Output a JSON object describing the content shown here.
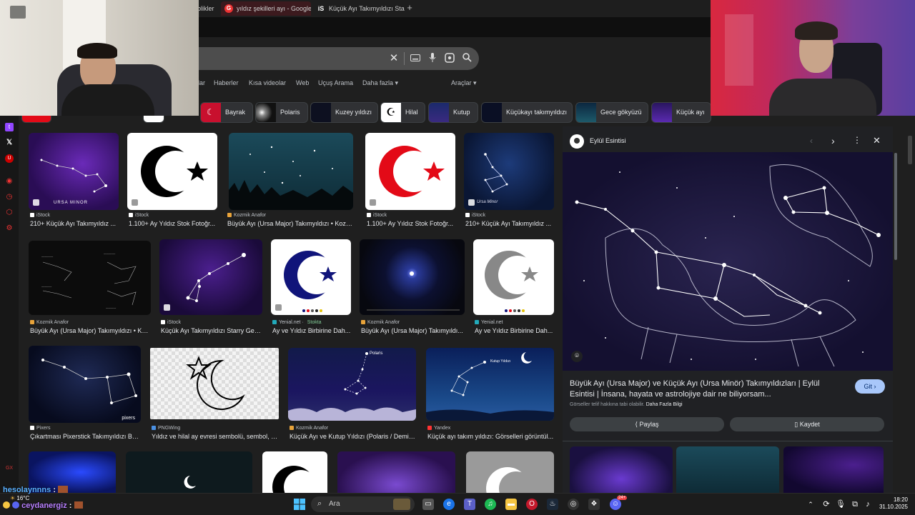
{
  "tabs": [
    {
      "label": "blikler",
      "active": false
    },
    {
      "label": "yıldız şekilleri ayı - Google",
      "active": true
    },
    {
      "label": "Küçük Ayı Takımyıldızı Sta",
      "active": false
    }
  ],
  "new_tab_label": "+",
  "search": {
    "value": "",
    "placeholder": ""
  },
  "nav_links": [
    "lar",
    "Haberler",
    "Kısa videolar",
    "Web",
    "Uçuş Arama",
    "Daha fazla"
  ],
  "tools_label": "Araçlar",
  "chips": [
    {
      "label": "Bayrak"
    },
    {
      "label": "Polaris"
    },
    {
      "label": "Kuzey yıldızı"
    },
    {
      "label": "Hilal"
    },
    {
      "label": "Kutup"
    },
    {
      "label": "Küçükayı takımyıldızı"
    },
    {
      "label": "Gece gökyüzü"
    },
    {
      "label": "Küçük ayı"
    }
  ],
  "results": [
    {
      "source": "iStock",
      "title": "210+ Küçük Ayı Takımyıldız ..."
    },
    {
      "source": "iStock",
      "title": "1.100+ Ay Yıldız Stok Fotoğr..."
    },
    {
      "source": "Kozmik Anafor",
      "title": "Büyük Ayı (Ursa Major) Takımyıldızı • Kozmi..."
    },
    {
      "source": "iStock",
      "title": "1.100+ Ay Yıldız Stok Fotoğr..."
    },
    {
      "source": "iStock",
      "title": "210+ Küçük Ayı Takımyıldız ..."
    },
    {
      "source": "Kozmik Anafor",
      "title": "Büyük Ayı (Ursa Major) Takımyıldızı • Ko..."
    },
    {
      "source": "iStock",
      "title": "Küçük Ayı Takımyıldızı Starry Gec..."
    },
    {
      "source": "Yenial.net",
      "title": "Ay ve Yıldız Birbirine Dah...",
      "extra": "Stokta"
    },
    {
      "source": "Kozmik Anafor",
      "title": "Büyük Ayı (Ursa Major) Takımyıldı..."
    },
    {
      "source": "Yenial.net",
      "title": "Ay ve Yıldız Birbirine Dah..."
    },
    {
      "source": "Pixers",
      "title": "Çıkartması Pixerstick Takımyıldızı Bü..."
    },
    {
      "source": "PNGWing",
      "title": "Yıldız ve hilal ay evresi sembolü, sembol, ç..."
    },
    {
      "source": "Kozmik Anafor",
      "title": "Küçük Ayı ve Kutup Yıldızı (Polaris / Demir ..."
    },
    {
      "source": "Yandex",
      "title": "Küçük ayı takım yıldızı: Görselleri görüntül..."
    }
  ],
  "image_labels": {
    "ursa_minor": "URSA MINOR",
    "ursa_minor2": "Ursa Minor",
    "pixers": "pixers",
    "polaris": "Polaris",
    "kutup": "Kutup Yıldızı"
  },
  "panel": {
    "site": "Eylül Esintisi",
    "title": "Büyük Ayı (Ursa Major) ve Küçük Ayı (Ursa Minör) Takımyıldızları | Eylül Esintisi | İnsana, hayata ve astrolojiye dair ne biliyorsam...",
    "git_label": "Git",
    "copyright": "Görseller telif hakkına tabi olabilir.",
    "more_info": "Daha Fazla Bilgi",
    "share_label": "Paylaş",
    "save_label": "Kaydet"
  },
  "taskbar": {
    "search_placeholder": "Ara",
    "time": "18:20",
    "date": "31.10.2025",
    "temperature": "16°C",
    "discord_badge": "24+"
  },
  "chat_overlay": [
    {
      "user": "hesolaynnns",
      "sep": ":"
    },
    {
      "user": "ceydanergiz",
      "sep": ":"
    }
  ],
  "colors": {
    "accent_red": "#e30a17",
    "chip_bg": "#303134",
    "panel_bg": "#202124",
    "git_button": "#a8c7fa"
  },
  "icons": [
    "search-icon",
    "mic-icon",
    "keyboard-icon",
    "lens-icon",
    "close-icon",
    "twitch-icon",
    "x-icon",
    "windows-icon"
  ]
}
